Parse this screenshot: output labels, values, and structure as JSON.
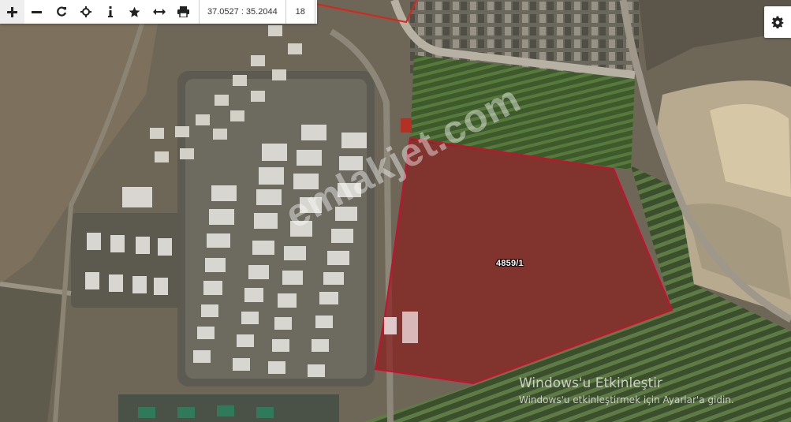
{
  "toolbar": {
    "buttons": [
      {
        "name": "zoom-in",
        "icon": "plus-icon"
      },
      {
        "name": "zoom-out",
        "icon": "minus-icon"
      },
      {
        "name": "refresh",
        "icon": "refresh-icon"
      },
      {
        "name": "locate",
        "icon": "crosshair-icon"
      },
      {
        "name": "info",
        "icon": "info-icon"
      },
      {
        "name": "favorite",
        "icon": "star-icon"
      },
      {
        "name": "measure",
        "icon": "horizontal-arrows-icon"
      },
      {
        "name": "print",
        "icon": "printer-icon"
      }
    ],
    "coordinates": "37.0527 : 35.2044",
    "zoom_level": "18"
  },
  "settings": {
    "icon": "gear-icon"
  },
  "map": {
    "parcel_label": "4859/1",
    "parcel_fill": "#8b1a1a",
    "parcel_border": "#c8102e",
    "watermark": "emlakjet.com"
  },
  "os_overlay": {
    "title": "Windows'u Etkinleştir",
    "subtitle": "Windows'u etkinleştirmek için Ayarlar'a gidin."
  }
}
